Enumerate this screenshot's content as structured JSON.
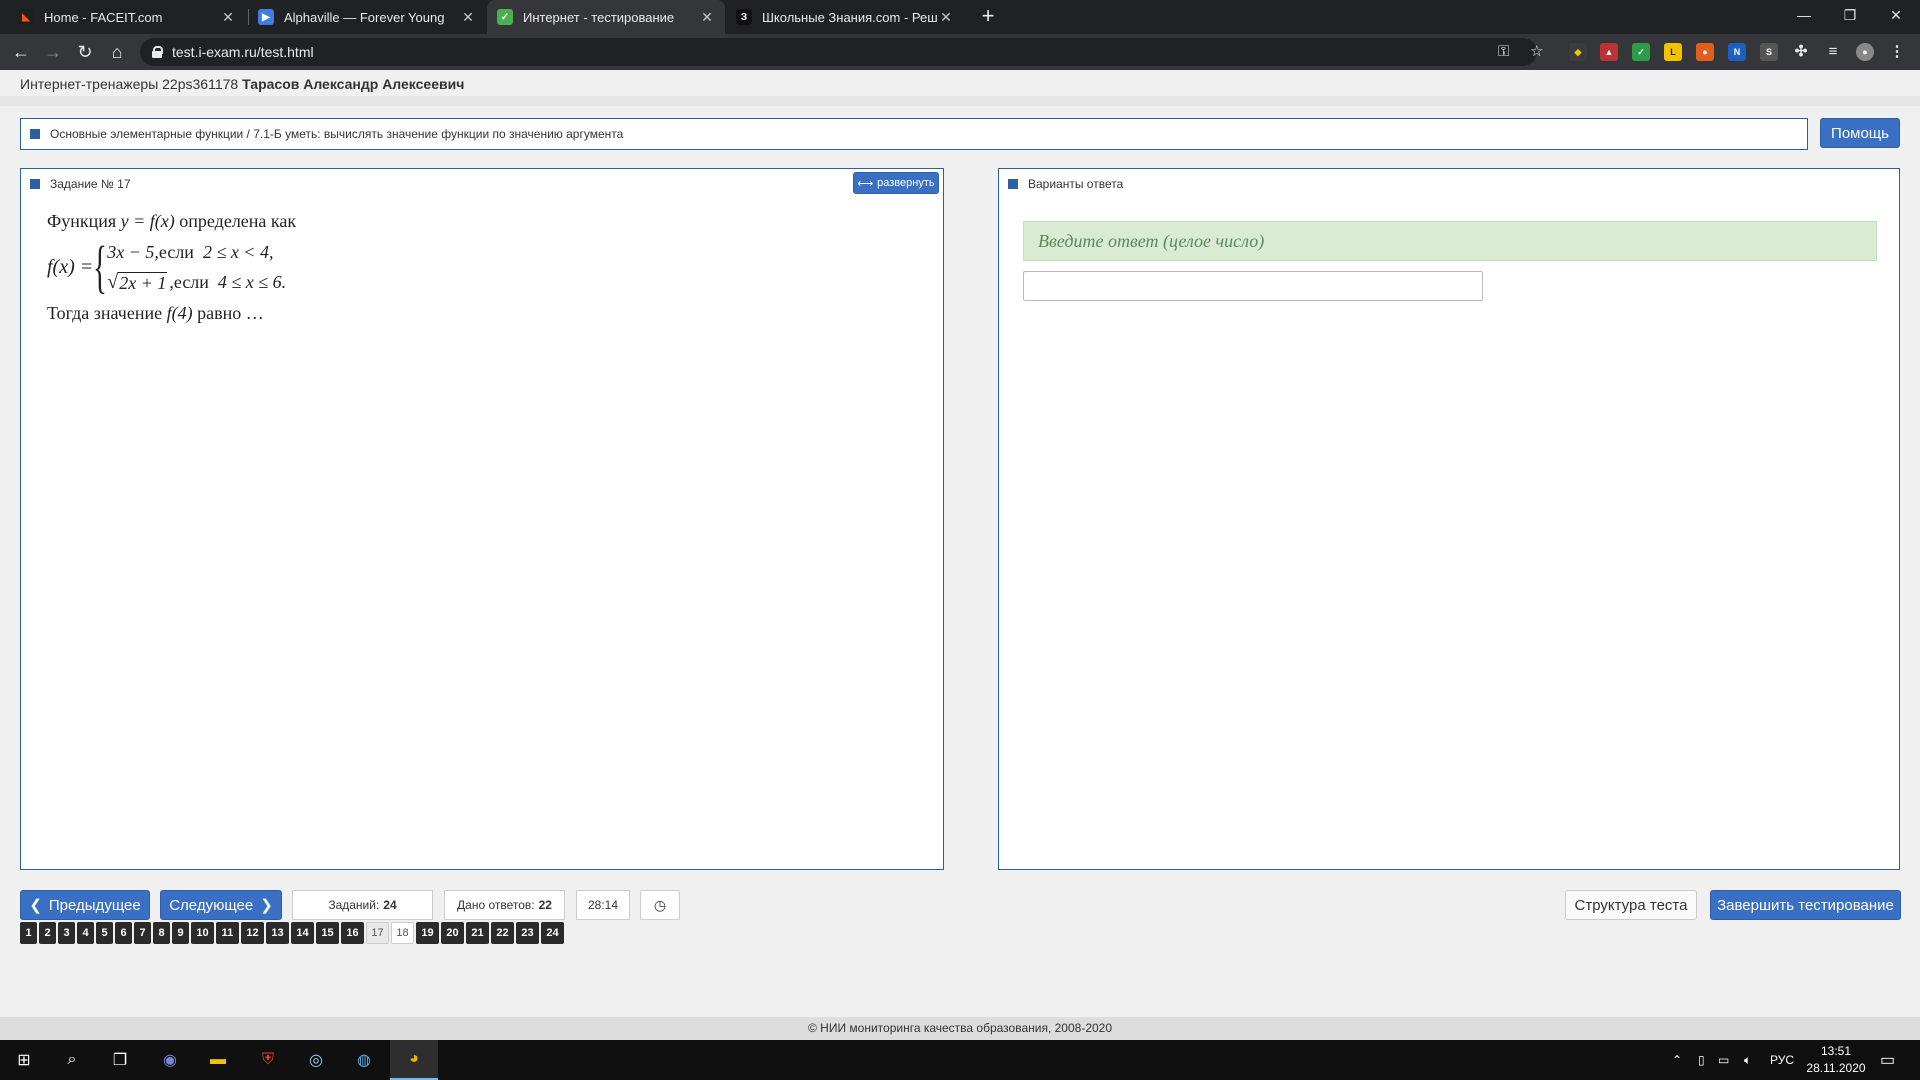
{
  "browser": {
    "tabs": [
      {
        "label": "Home - FACEIT.com",
        "icon": "faceit-icon",
        "color": "#ff5500"
      },
      {
        "label": "Alphaville — Forever Young",
        "icon": "youtube-music-icon",
        "color": "#3d7ee0"
      },
      {
        "label": "Интернет - тестирование",
        "icon": "test-site-icon",
        "color": "#4caf50"
      },
      {
        "label": "Школьные Знания.com - Решае",
        "icon": "znanija-icon",
        "color": "#111111"
      }
    ],
    "url": "test.i-exam.ru/test.html"
  },
  "header": {
    "user_prefix": "Интернет-тренажеры 22ps361178",
    "user_name": "Тарасов Александр Алексеевич"
  },
  "breadcrumb": "Основные элементарные функции / 7.1-Б уметь: вычислять значение функции по значению аргумента",
  "help_button": "Помощь",
  "task_panel": {
    "title": "Задание № 17",
    "expand_button": "развернуть",
    "intro_word": "Функция",
    "intro_formula": "y = f(x)",
    "intro_tail": "определена как",
    "lhs": "f(x) =",
    "case1_expr": "3x − 5,",
    "case1_cond_word": "если",
    "case1_cond": "2 ≤ x < 4,",
    "case2_sqrt_arg": "2x + 1",
    "case2_tail": ",",
    "case2_cond_word": "если",
    "case2_cond": "4 ≤ x ≤ 6.",
    "question_word": "Тогда значение",
    "question_formula": "f(4)",
    "question_tail": "равно …"
  },
  "answer_panel": {
    "title": "Варианты ответа",
    "hint": "Введите ответ (целое число)",
    "input_value": ""
  },
  "bottom": {
    "prev_button": "Предыдущее",
    "next_button": "Следующее",
    "tasks_label": "Заданий:",
    "tasks_count": "24",
    "answered_label": "Дано ответов:",
    "answered_count": "22",
    "timer": "28:14",
    "structure_button": "Структура теста",
    "finish_button": "Завершить тестирование"
  },
  "question_numbers": [
    "1",
    "2",
    "3",
    "4",
    "5",
    "6",
    "7",
    "8",
    "9",
    "10",
    "11",
    "12",
    "13",
    "14",
    "15",
    "16",
    "17",
    "18",
    "19",
    "20",
    "21",
    "22",
    "23",
    "24"
  ],
  "current_question": "17",
  "unanswered_question": "18",
  "footer": "© НИИ мониторинга качества образования, 2008-2020",
  "taskbar": {
    "language": "РУС",
    "time": "13:51",
    "date": "28.11.2020"
  },
  "colors": {
    "accent": "#3a70c4",
    "hint_bg": "#d9ecd3",
    "hint_text": "#5a8a55"
  }
}
